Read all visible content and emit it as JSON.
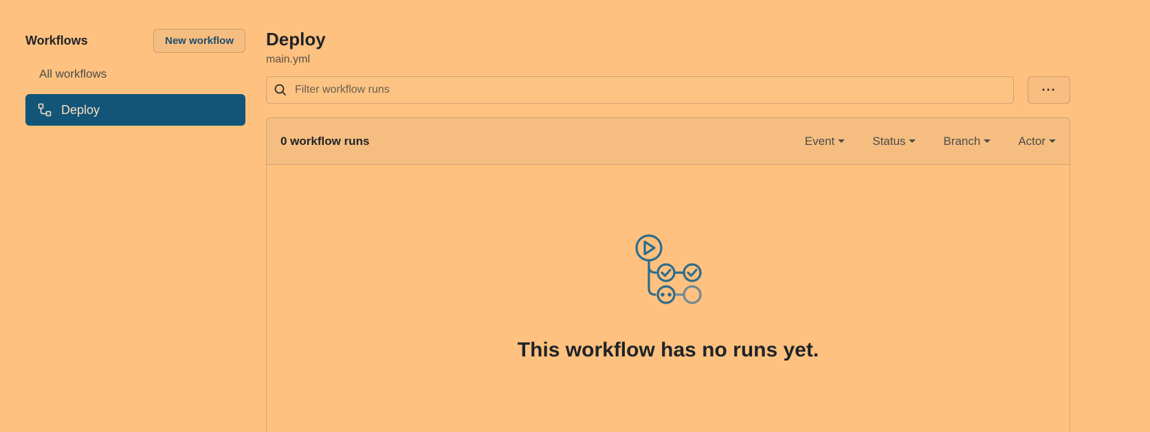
{
  "sidebar": {
    "title": "Workflows",
    "new_button": "New workflow",
    "items": [
      {
        "label": "All workflows",
        "active": false
      },
      {
        "label": "Deploy",
        "active": true,
        "icon": "workflow-icon"
      }
    ]
  },
  "header": {
    "title": "Deploy",
    "subtitle": "main.yml"
  },
  "search": {
    "placeholder": "Filter workflow runs",
    "icon": "search-icon"
  },
  "more_button": "···",
  "runs": {
    "count_label": "0 workflow runs",
    "filters": [
      "Event",
      "Status",
      "Branch",
      "Actor"
    ]
  },
  "empty_state": {
    "icon": "actions-illustration-icon",
    "message": "This workflow has no runs yet."
  },
  "colors": {
    "background": "#fec17f",
    "accent": "#125578",
    "icon": "#2e6b8a"
  }
}
